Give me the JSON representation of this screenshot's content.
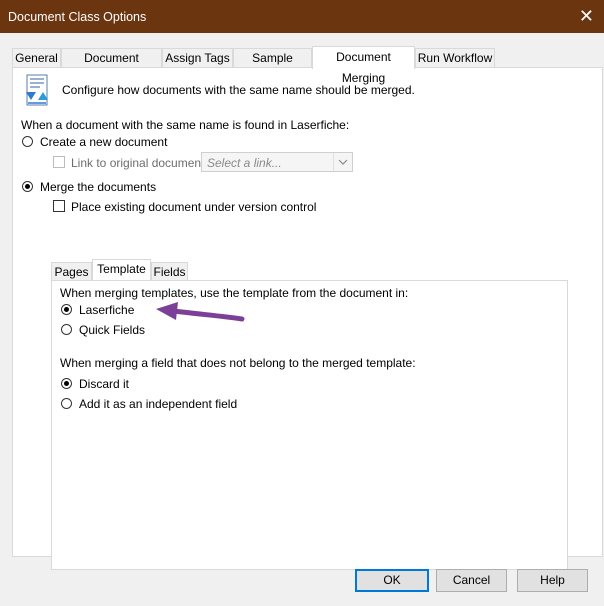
{
  "window": {
    "title": "Document Class Options",
    "close_glyph": "✕"
  },
  "outer_tabs": [
    {
      "label": "General"
    },
    {
      "label": "Document Storage"
    },
    {
      "label": "Assign Tags"
    },
    {
      "label": "Sample Pages"
    },
    {
      "label": "Document Merging",
      "active": true
    },
    {
      "label": "Run Workflow"
    }
  ],
  "merging": {
    "description": "Configure how documents with the same name should be merged.",
    "same_name_prompt": "When a document with the same name is found in Laserfiche:",
    "create_new_label": "Create a new document",
    "link_original_label": "Link to original document",
    "link_select_placeholder": "Select a link...",
    "merge_label": "Merge the documents",
    "version_control_label": "Place existing document under version control"
  },
  "inner_tabs": [
    {
      "label": "Pages"
    },
    {
      "label": "Template",
      "active": true
    },
    {
      "label": "Fields"
    }
  ],
  "template": {
    "template_prompt": "When merging templates, use the template from the document in:",
    "option_laserfiche": "Laserfiche",
    "option_quick_fields": "Quick Fields",
    "field_prompt": "When merging a field that does not belong to the merged template:",
    "option_discard": "Discard it",
    "option_add_independent": "Add it as an independent field"
  },
  "buttons": {
    "ok": "OK",
    "cancel": "Cancel",
    "help": "Help"
  },
  "colors": {
    "titlebar": "#6b3510",
    "annotation_arrow": "#7b3f98",
    "accent": "#0078d7"
  },
  "icons": {
    "merge_icon": "document-merge-icon",
    "annotation": "purple-arrow-annotation"
  }
}
